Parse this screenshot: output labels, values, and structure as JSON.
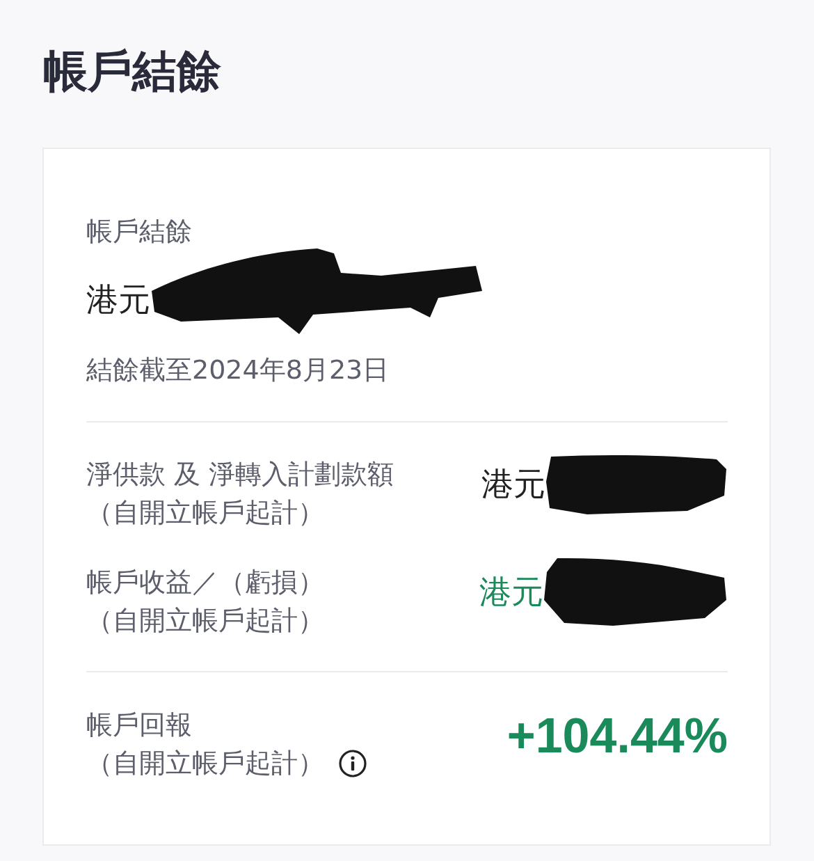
{
  "page_title": "帳戶結餘",
  "balance": {
    "label": "帳戶結餘",
    "currency": "港元",
    "redacted": true,
    "as_of": "結餘截至2024年8月23日"
  },
  "rows": [
    {
      "label": "淨供款 及 淨轉入計劃款額",
      "note": "（自開立帳戶起計）",
      "currency": "港元",
      "redacted": true,
      "color": "#222222"
    },
    {
      "label": "帳戶收益／（虧損）",
      "note": "（自開立帳戶起計）",
      "currency": "港元",
      "redacted": true,
      "color": "#1a8a5a"
    }
  ],
  "return": {
    "label": "帳戶回報",
    "note": "（自開立帳戶起計）",
    "value": "+104.44%"
  }
}
